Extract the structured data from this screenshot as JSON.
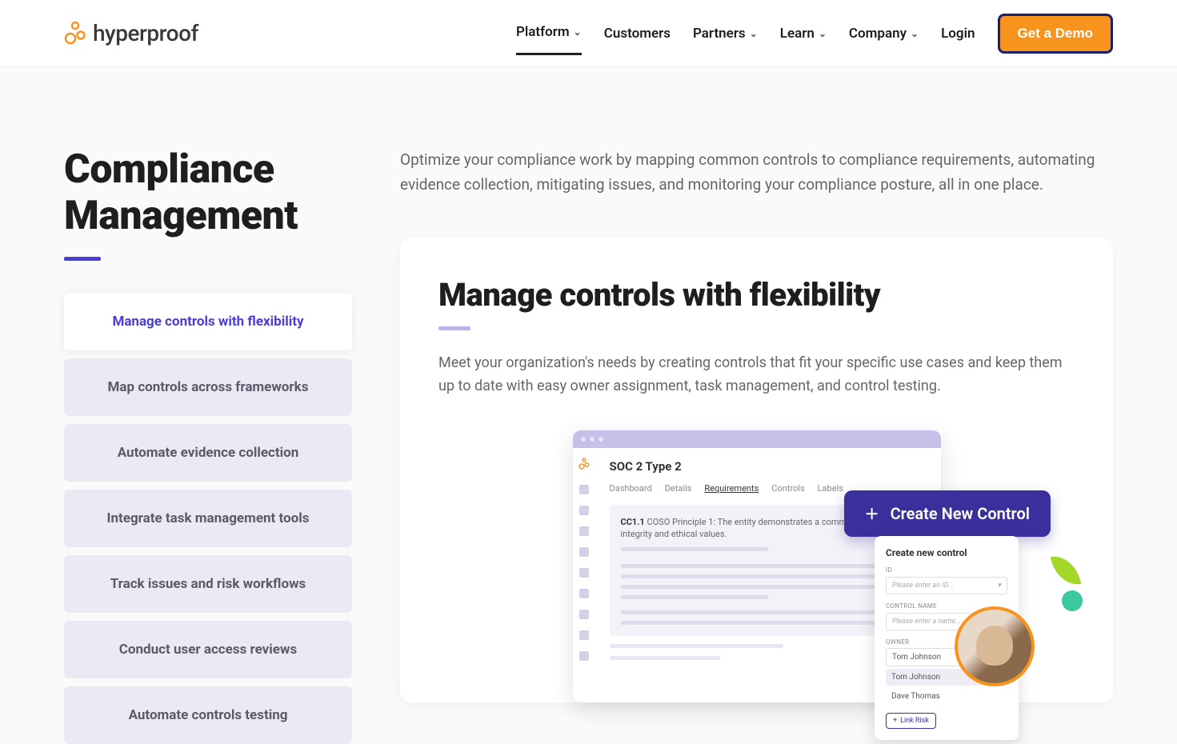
{
  "header": {
    "logo_text": "hyperproof",
    "nav": [
      "Platform",
      "Customers",
      "Partners",
      "Learn",
      "Company",
      "Login"
    ],
    "nav_has_dropdown": [
      true,
      false,
      true,
      true,
      true,
      false
    ],
    "demo_button": "Get a Demo"
  },
  "page": {
    "title": "Compliance Management",
    "intro": "Optimize your compliance work by mapping common controls to compliance requirements, automating evidence collection, mitigating issues, and monitoring your compliance posture, all in one place."
  },
  "tabs": [
    "Manage controls with flexibility",
    "Map controls across frameworks",
    "Automate evidence collection",
    "Integrate task management tools",
    "Track issues and risk workflows",
    "Conduct user access reviews",
    "Automate controls testing"
  ],
  "content": {
    "title": "Manage controls with flexibility",
    "body": "Meet your organization's needs by creating controls that fit your specific use cases and keep them up to date with easy owner assignment, task management, and control testing."
  },
  "mockup": {
    "app_title": "SOC 2 Type 2",
    "app_tabs": [
      "Dashboard",
      "Details",
      "Requirements",
      "Controls",
      "Labels"
    ],
    "requirement_code": "CC1.1",
    "requirement_text": " COSO Principle 1: The entity demonstrates a commitment to integrity and ethical values.",
    "create_button": "Create New Control",
    "panel": {
      "title": "Create new control",
      "id_label": "ID",
      "id_placeholder": "Please enter an ID...",
      "name_label": "CONTROL NAME",
      "name_placeholder": "Please enter a name...",
      "owner_label": "OWNER",
      "owner1": "Tom Johnson",
      "owner2": "Tom Johnson",
      "owner3": "Dave Thomas",
      "link_risk": "Link Risk"
    }
  }
}
